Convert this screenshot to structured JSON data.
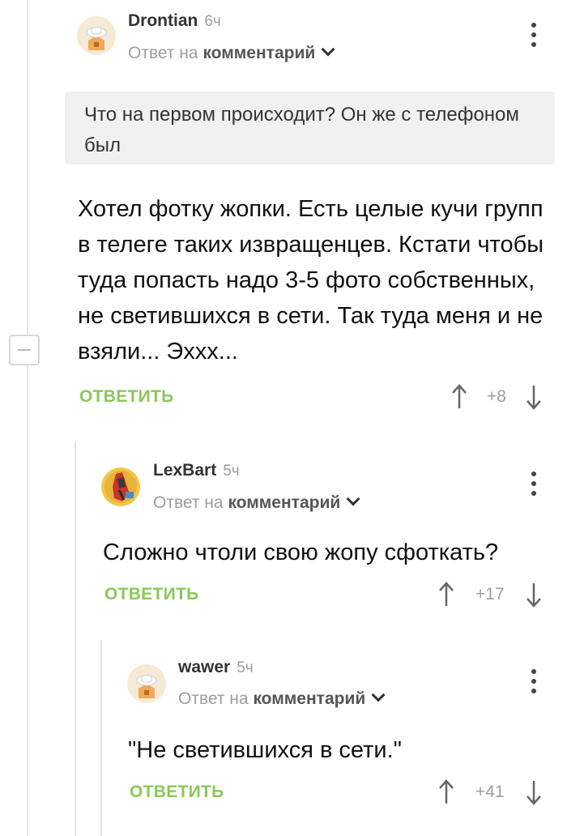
{
  "comments": [
    {
      "author": "Drontian",
      "time": "6ч",
      "reply_prefix": "Ответ на",
      "reply_link": "комментарий",
      "quote": "Что на первом происходит? Он же с телефоном был",
      "text": "Хотел фотку жопки. Есть целые кучи групп в телеге таких извращенцев. Кстати чтобы туда попасть надо 3-5 фото собственных, не светившихся в сети. Так туда меня и не взяли... Эххх...",
      "reply_label": "ОТВЕТИТЬ",
      "score": "+8"
    },
    {
      "author": "LexBart",
      "time": "5ч",
      "reply_prefix": "Ответ на",
      "reply_link": "комментарий",
      "text": "Сложно чтоли свою жопу сфоткать?",
      "reply_label": "ОТВЕТИТЬ",
      "score": "+17"
    },
    {
      "author": "wawer",
      "time": "5ч",
      "reply_prefix": "Ответ на",
      "reply_link": "комментарий",
      "text": "\"Не светившихся в сети.\"",
      "reply_label": "ОТВЕТИТЬ",
      "score": "+41"
    }
  ],
  "colors": {
    "accent": "#8ac858",
    "muted": "#9e9e9e",
    "quote_bg": "#f1f1f1"
  },
  "icons": [
    "collapse-icon",
    "more-icon",
    "chevron-down-icon",
    "arrow-up-icon",
    "arrow-down-icon",
    "avatar-chef-icon"
  ]
}
